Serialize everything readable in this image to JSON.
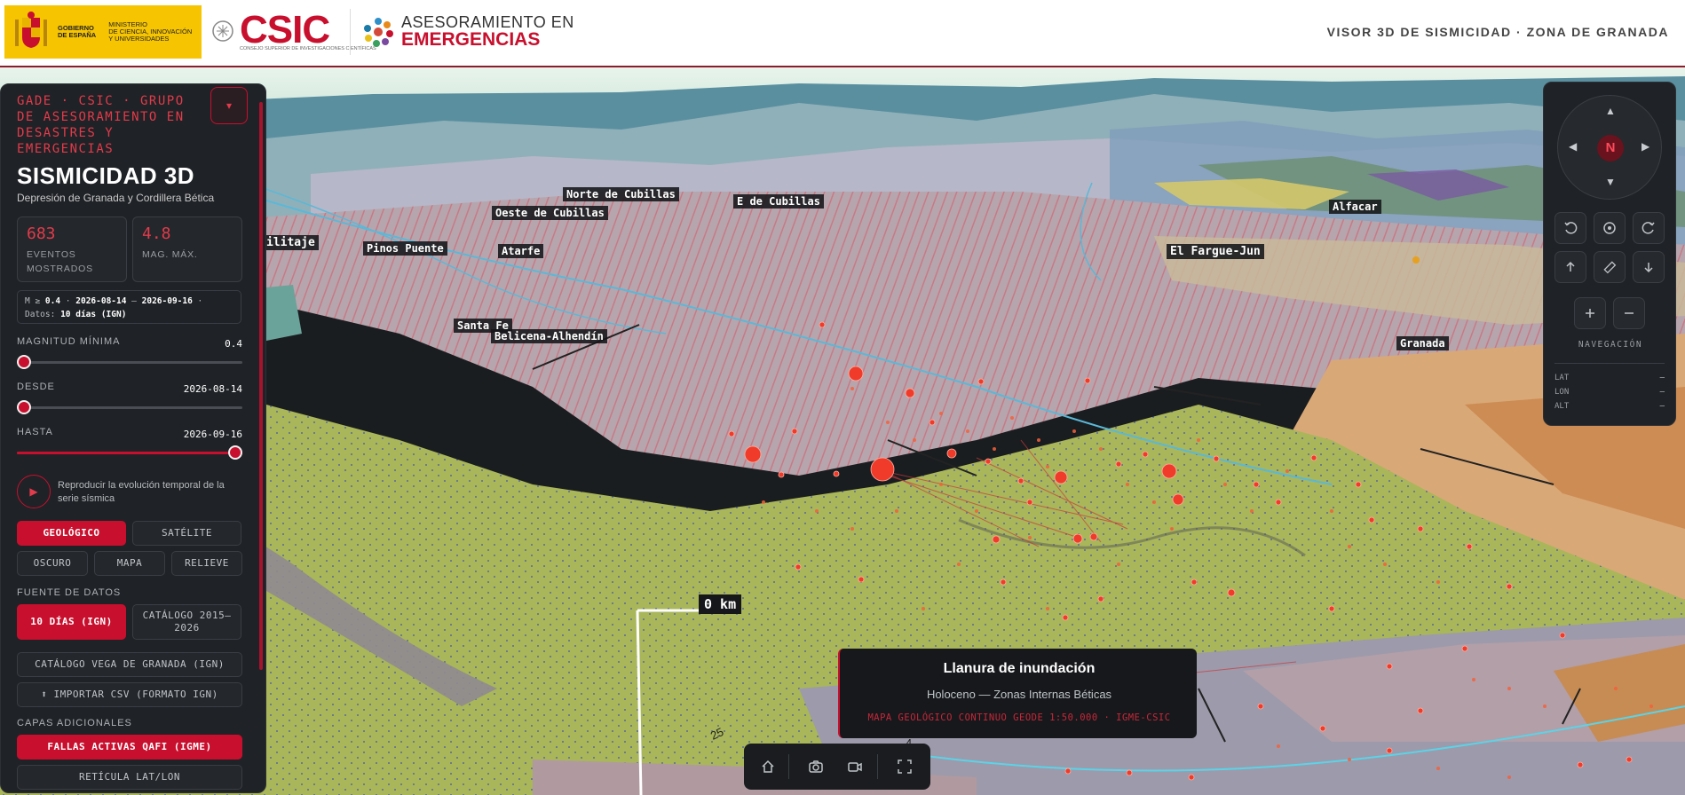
{
  "header": {
    "gob_line1": "GOBIERNO",
    "gob_line2": "DE ESPAÑA",
    "ministry_line1": "MINISTERIO",
    "ministry_line2": "DE CIENCIA, INNOVACIÓN",
    "ministry_line3": "Y UNIVERSIDADES",
    "csic_mark": "CSIC",
    "csic_sub": "CONSEJO SUPERIOR DE INVESTIGACIONES CIENTÍFICAS",
    "ae_top": "ASESORAMIENTO EN",
    "ae_bottom": "EMERGENCIAS",
    "title": "VISOR 3D DE SISMICIDAD · ZONA DE GRANADA"
  },
  "panel": {
    "org": "GADE · CSIC · GRUPO DE ASESORAMIENTO EN DESASTRES Y EMERGENCIAS",
    "collapse_icon": "▾",
    "title": "SISMICIDAD 3D",
    "subtitle": "Depresión de Granada y Cordillera Bética",
    "stats": [
      {
        "value": "683",
        "label": "EVENTOS MOSTRADOS"
      },
      {
        "value": "4.8",
        "label": "MAG. MÁX."
      }
    ],
    "filter": {
      "mag_prefix": "M ≥",
      "mag": "0.4",
      "from": "2026-08-14",
      "to": "2026-09-16",
      "source_prefix": "Datos:",
      "source": "10 días (IGN)"
    },
    "sliders": [
      {
        "label": "MAGNITUD MÍNIMA",
        "value": "0.4",
        "fraction": 0.0
      },
      {
        "label": "DESDE",
        "value": "2026-08-14",
        "fraction": 0.0
      },
      {
        "label": "HASTA",
        "value": "2026-09-16",
        "fraction": 1.0
      }
    ],
    "play_icon": "▶",
    "play_text": "Reproducir la evolución temporal de la serie sísmica",
    "basemaps": [
      "GEOLÓGICO",
      "SATÉLITE",
      "OSCURO",
      "MAPA",
      "RELIEVE"
    ],
    "source_label": "FUENTE DE DATOS",
    "sources": [
      "10 DÍAS (IGN)",
      "CATÁLOGO 2015–2026",
      "CATÁLOGO VEGA DE GRANADA (IGN)",
      "⬆ IMPORTAR CSV (FORMATO IGN)"
    ],
    "layers_label": "CAPAS ADICIONALES",
    "layers": [
      "FALLAS ACTIVAS QAFI (IGME)",
      "RETÍCULA LAT/LON"
    ]
  },
  "map": {
    "places": [
      "Norte de Cubillas",
      "E de Cubillas",
      "Oeste de Cubillas",
      "ilitaje",
      "Pinos Puente",
      "Atarfe",
      "Alfacar",
      "El Fargue-Jun",
      "Santa Fe",
      "Belicena-Alhendín",
      "Granada"
    ],
    "scale": "0 km",
    "contour_labels": [
      "25",
      "4"
    ]
  },
  "nav": {
    "north": "N",
    "label": "NAVEGACIÓN",
    "coords": [
      {
        "key": "LAT",
        "value": "–"
      },
      {
        "key": "LON",
        "value": "–"
      },
      {
        "key": "ALT",
        "value": "–"
      }
    ]
  },
  "popup": {
    "title": "Llanura de inundación",
    "subtitle": "Holoceno — Zonas Internas Béticas",
    "source": "MAPA GEOLÓGICO CONTINUO GEODE 1:50.000 · IGME-CSIC"
  },
  "colors": {
    "accent": "#c8102e",
    "panel_bg": "#1f2226",
    "plain_green": "#a9b65a",
    "event_red": "#f03a2a"
  }
}
